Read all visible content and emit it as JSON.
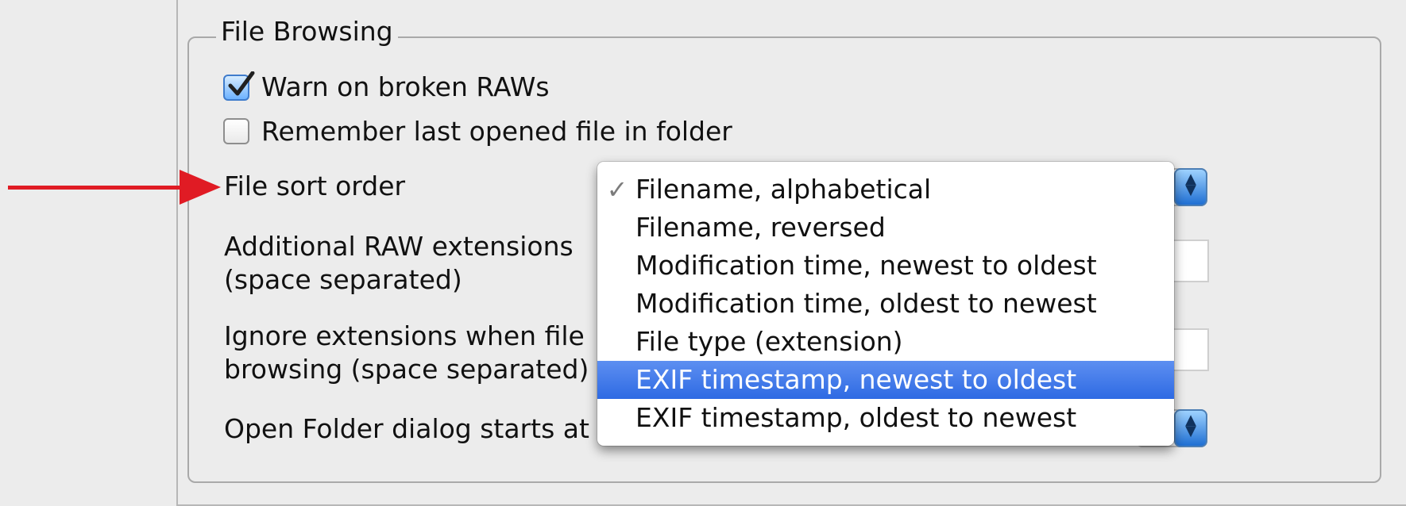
{
  "section": {
    "title": "File Browsing"
  },
  "checkboxes": [
    {
      "label": "Warn on broken RAWs",
      "checked": true
    },
    {
      "label": "Remember last opened file in folder",
      "checked": false
    }
  ],
  "settings": {
    "sort_order_label": "File sort order",
    "raw_extensions_label_1": "Additional RAW extensions",
    "raw_extensions_label_2": "(space separated)",
    "ignore_extensions_label_1": "Ignore extensions when file",
    "ignore_extensions_label_2": "browsing (space separated)",
    "open_folder_label": "Open Folder dialog starts at"
  },
  "sort_menu": {
    "items": [
      {
        "label": "Filename, alphabetical",
        "checked": true,
        "highlighted": false
      },
      {
        "label": "Filename, reversed",
        "checked": false,
        "highlighted": false
      },
      {
        "label": "Modification time, newest to oldest",
        "checked": false,
        "highlighted": false
      },
      {
        "label": "Modification time, oldest to newest",
        "checked": false,
        "highlighted": false
      },
      {
        "label": "File type (extension)",
        "checked": false,
        "highlighted": false
      },
      {
        "label": "EXIF timestamp, newest to oldest",
        "checked": false,
        "highlighted": true
      },
      {
        "label": "EXIF timestamp, oldest to newest",
        "checked": false,
        "highlighted": false
      }
    ],
    "check_glyph": "✓"
  },
  "icons": {
    "checkbox_check": "checkmark-icon",
    "combo_arrows": "up-down-arrows-icon",
    "annotation_arrow": "red-arrow-icon"
  },
  "colors": {
    "annotation_arrow": "#e01b24",
    "selection": "#2e6ae3",
    "checkbox_accent": "#3f7ccc"
  }
}
